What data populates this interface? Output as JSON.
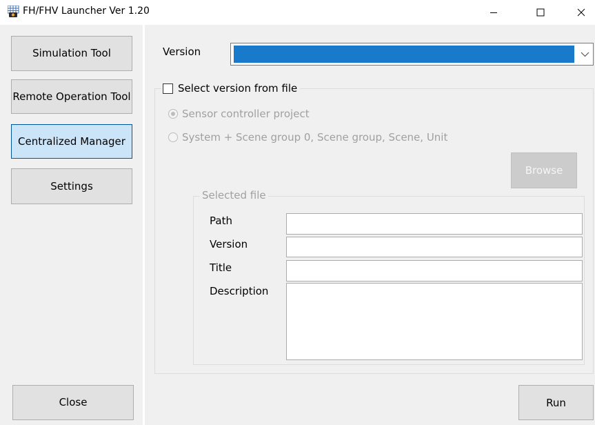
{
  "window": {
    "title": "FH/FHV Launcher Ver 1.20",
    "app_icon": "launcher-icon",
    "controls": [
      "minimize-icon",
      "maximize-icon",
      "close-icon"
    ]
  },
  "nav": {
    "simulation_tool": "Simulation Tool",
    "remote_operation_tool": "Remote Operation Tool",
    "centralized_manager": "Centralized Manager",
    "settings": "Settings",
    "close": "Close",
    "active_item": "centralized_manager"
  },
  "version": {
    "label": "Version",
    "selected_value": ""
  },
  "select_from_file": {
    "label": "Select version from file",
    "checked": false,
    "options": [
      {
        "label": "Sensor controller project",
        "selected": true,
        "enabled": false
      },
      {
        "label": "System + Scene group 0, Scene group, Scene, Unit",
        "selected": false,
        "enabled": false
      }
    ],
    "browse_label": "Browse"
  },
  "selected_file": {
    "group_label": "Selected file",
    "path_label": "Path",
    "path_value": "",
    "version_label": "Version",
    "version_value": "",
    "title_label": "Title",
    "title_value": "",
    "description_label": "Description",
    "description_value": ""
  },
  "actions": {
    "run_label": "Run"
  },
  "colors": {
    "selection_blue": "#1979ca",
    "active_nav_bg": "#cce4f7",
    "active_nav_border": "#005499",
    "panel_bg": "#f0f0f0"
  }
}
